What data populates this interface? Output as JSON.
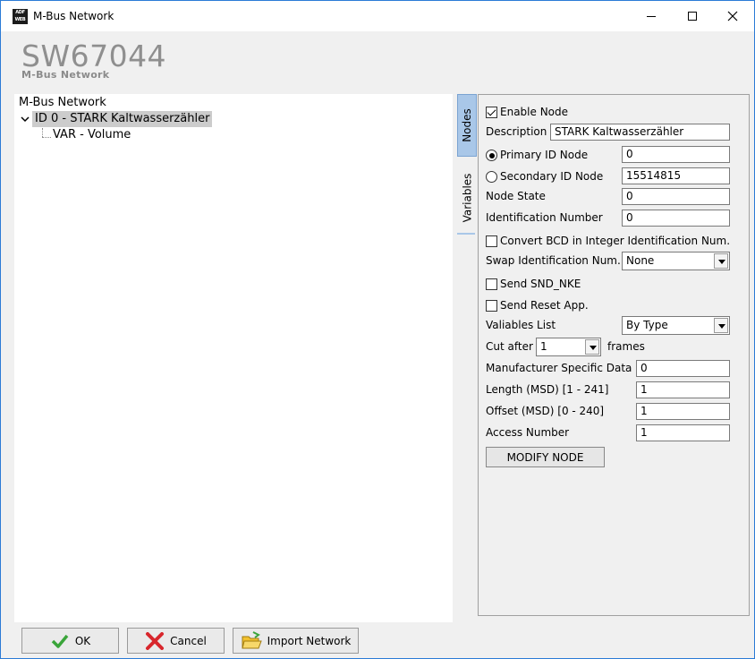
{
  "window": {
    "title": "M-Bus Network",
    "app_icon_text": "ADF WEB"
  },
  "header": {
    "product": "SW67044",
    "subtitle": "M-Bus Network"
  },
  "tree": {
    "root": "M-Bus Network",
    "node": "ID 0 - STARK Kaltwasserzähler",
    "leaf": "VAR - Volume"
  },
  "tabs": {
    "nodes": "Nodes",
    "variables": "Variables"
  },
  "form": {
    "enable_node_label": "Enable Node",
    "enable_node_checked": true,
    "description_label": "Description",
    "description_value": "STARK Kaltwasserzähler",
    "primary_id_label": "Primary ID Node",
    "primary_id_value": "0",
    "primary_selected": true,
    "secondary_id_label": "Secondary ID Node",
    "secondary_id_value": "15514815",
    "node_state_label": "Node State",
    "node_state_value": "0",
    "identification_number_label": "Identification Number",
    "identification_number_value": "0",
    "convert_bcd_label": "Convert BCD in Integer Identification Num.",
    "convert_bcd_checked": false,
    "swap_label": "Swap Identification Num.",
    "swap_value": "None",
    "send_snd_nke_label": "Send SND_NKE",
    "send_snd_nke_checked": false,
    "send_reset_label": "Send Reset App.",
    "send_reset_checked": false,
    "variables_list_label": "Valiables List",
    "variables_list_value": "By Type",
    "cut_after_label": "Cut after",
    "cut_after_value": "1",
    "frames_label": "frames",
    "manufacturer_label": "Manufacturer Specific Data",
    "manufacturer_value": "0",
    "length_label": "Length (MSD) [1 - 241]",
    "length_value": "1",
    "offset_label": "Offset (MSD) [0 - 240]",
    "offset_value": "1",
    "access_label": "Access Number",
    "access_value": "1",
    "modify_button": "MODIFY NODE"
  },
  "buttons": {
    "ok": "OK",
    "cancel": "Cancel",
    "import": "Import Network"
  },
  "colors": {
    "accent_tab": "#a9c7e8",
    "title_gray": "#8f8f8f",
    "ok_check": "#3aa53a",
    "cancel_x": "#d8262c",
    "folder": "#f2c12e"
  }
}
